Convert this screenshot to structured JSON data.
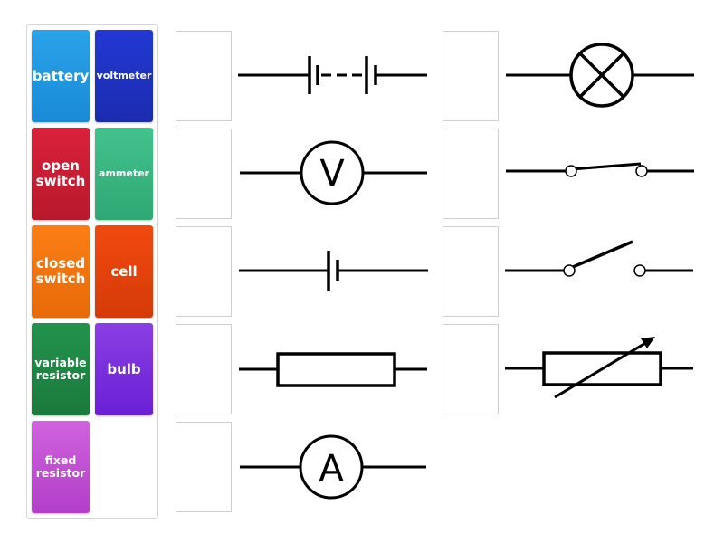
{
  "tiles": [
    {
      "label": "battery",
      "color_top": "#2aa3ea",
      "color_bottom": "#1a8ad6"
    },
    {
      "label": "voltmeter",
      "color_top": "#2238d4",
      "color_bottom": "#1b2cb0"
    },
    {
      "label": "open switch",
      "color_top": "#d9213a",
      "color_bottom": "#b8192c"
    },
    {
      "label": "ammeter",
      "color_top": "#42c28c",
      "color_bottom": "#2fa874"
    },
    {
      "label": "closed switch",
      "color_top": "#fb7e14",
      "color_bottom": "#e86a08"
    },
    {
      "label": "cell",
      "color_top": "#f14a0f",
      "color_bottom": "#d63a08"
    },
    {
      "label": "variable resistor",
      "color_top": "#23934c",
      "color_bottom": "#1a7a3c"
    },
    {
      "label": "bulb",
      "color_top": "#8a3fe3",
      "color_bottom": "#6a1fd6"
    },
    {
      "label": "fixed resistor",
      "color_top": "#d062de",
      "color_bottom": "#b23fc8"
    }
  ],
  "targets": [
    {
      "symbol": "battery-symbol"
    },
    {
      "symbol": "voltmeter-symbol"
    },
    {
      "symbol": "cell-symbol"
    },
    {
      "symbol": "fixed-resistor-symbol"
    },
    {
      "symbol": "ammeter-symbol",
      "letter": "A"
    },
    {
      "symbol": "bulb-symbol"
    },
    {
      "symbol": "open-switch-symbol"
    },
    {
      "symbol": "closed-switch-symbol"
    },
    {
      "symbol": "variable-resistor-symbol"
    }
  ],
  "symbol_letters": {
    "voltmeter": "V",
    "ammeter": "A"
  },
  "colors": {
    "stroke": "#000000",
    "slot_border": "#cfcfcf",
    "tray_border": "#d4d4d4"
  }
}
